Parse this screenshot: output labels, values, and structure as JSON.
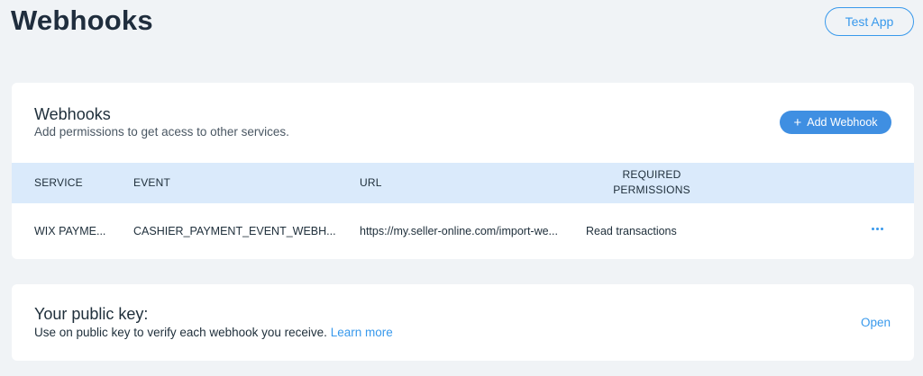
{
  "page": {
    "title": "Webhooks",
    "test_app_label": "Test App"
  },
  "webhooks_section": {
    "title": "Webhooks",
    "subtitle": "Add permissions to get acess to other services.",
    "add_button_label": "Add Webhook",
    "add_button_icon": "plus-icon",
    "table": {
      "columns": [
        "SERVICE",
        "EVENT",
        "URL",
        "REQUIRED",
        "PERMISSIONS"
      ],
      "rows": [
        {
          "service": "WIX PAYME...",
          "event": "CASHIER_PAYMENT_EVENT_WEBH...",
          "url": "https://my.seller-online.com/import-we...",
          "permissions": "Read transactions",
          "actions_icon": "more-horizontal-icon"
        }
      ]
    }
  },
  "public_key_section": {
    "title": "Your public key:",
    "description": "Use on public key to verify each webhook you receive.",
    "learn_more_label": "Learn more",
    "open_label": "Open"
  },
  "colors": {
    "background": "#f0f3f6",
    "accent": "#3899ec",
    "button": "#3f8fe2",
    "table_header": "#daeafb"
  }
}
